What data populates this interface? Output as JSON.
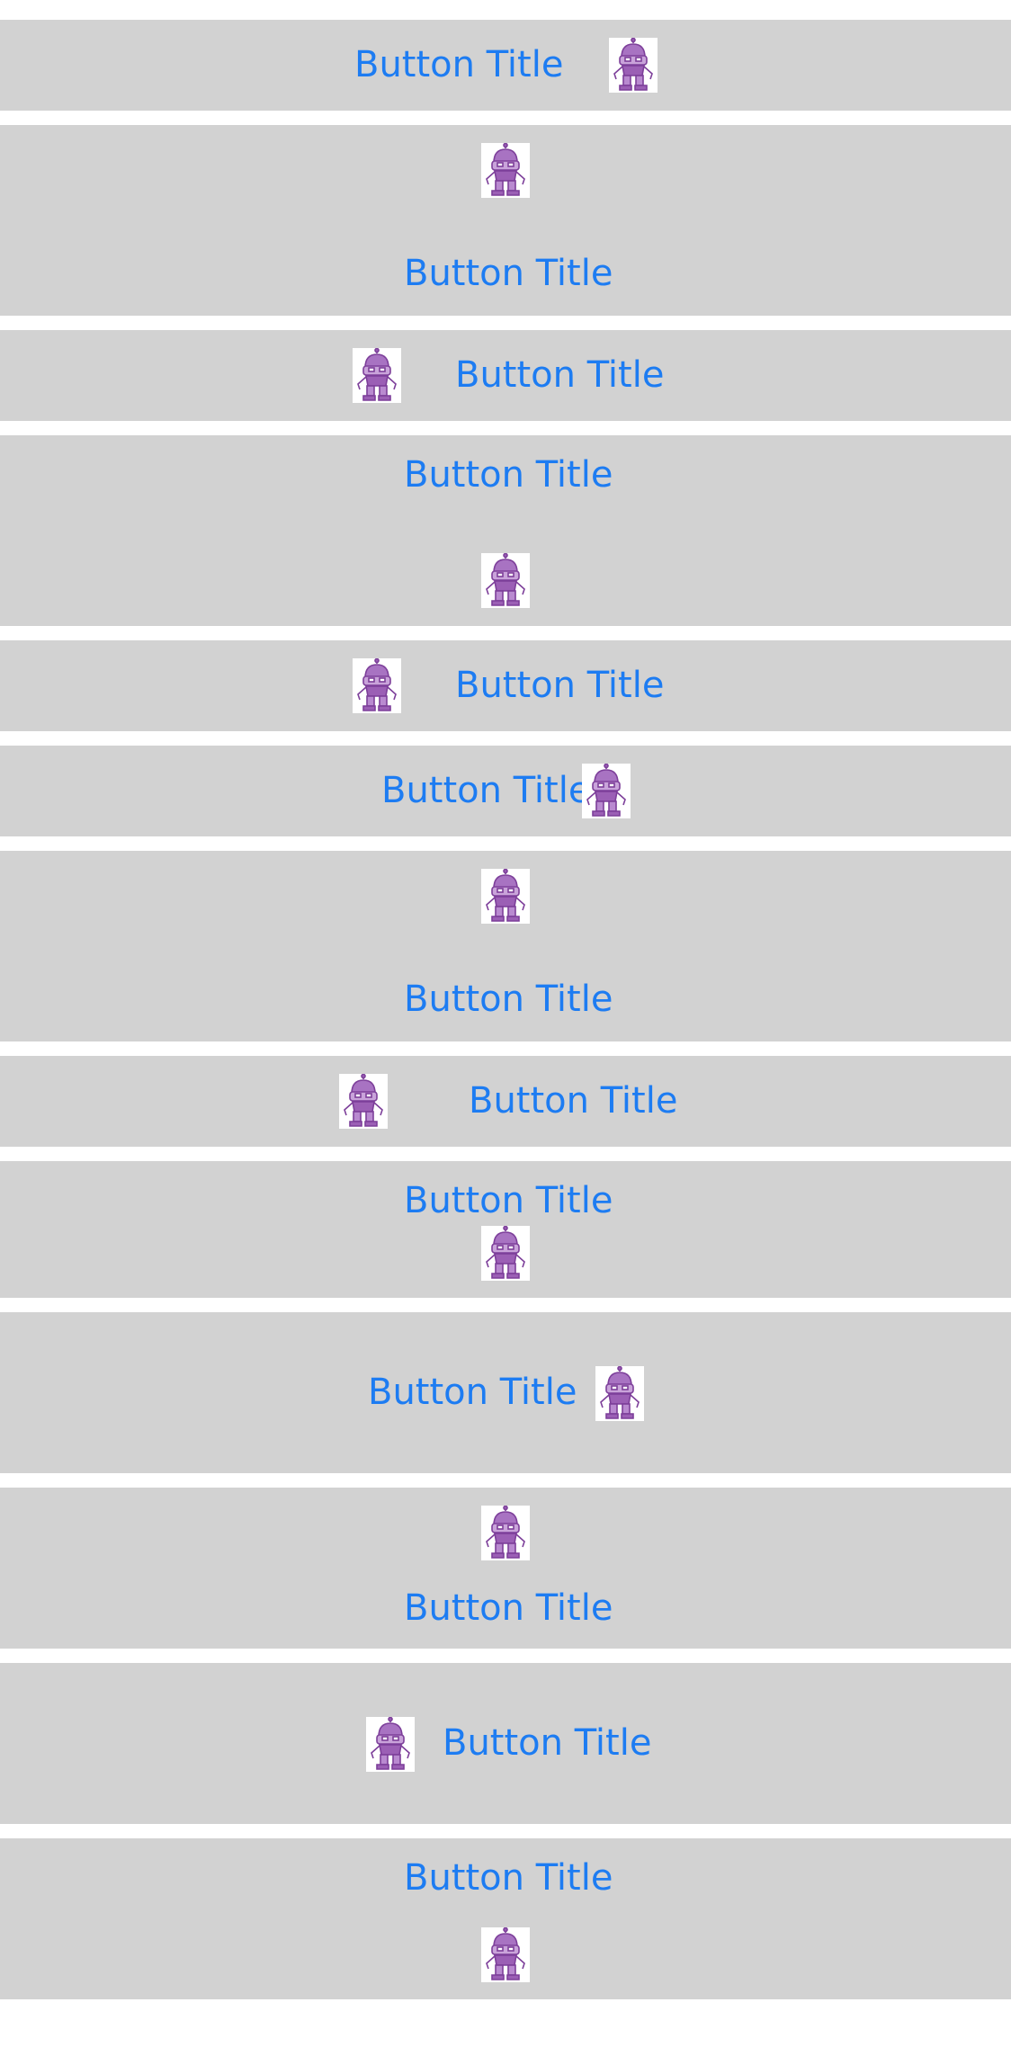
{
  "colors": {
    "button_bg": "#d2d2d2",
    "title_text": "#1d7cf2",
    "robot": "#9b5fb5"
  },
  "buttons": [
    {
      "title": "Button Title",
      "icon": "robot-icon"
    },
    {
      "title": "Button Title",
      "icon": "robot-icon"
    },
    {
      "title": "Button Title",
      "icon": "robot-icon"
    },
    {
      "title": "Button Title",
      "icon": "robot-icon"
    },
    {
      "title": "Button Title",
      "icon": "robot-icon"
    },
    {
      "title": "Button Title",
      "icon": "robot-icon"
    },
    {
      "title": "Button Title",
      "icon": "robot-icon"
    },
    {
      "title": "Button Title",
      "icon": "robot-icon"
    },
    {
      "title": "Button Title",
      "icon": "robot-icon"
    },
    {
      "title": "Button Title",
      "icon": "robot-icon"
    },
    {
      "title": "Button Title",
      "icon": "robot-icon"
    },
    {
      "title": "Button Title",
      "icon": "robot-icon"
    },
    {
      "title": "Button Title",
      "icon": "robot-icon"
    }
  ]
}
